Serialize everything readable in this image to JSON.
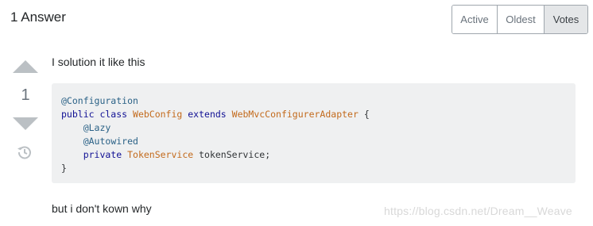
{
  "answers_header": {
    "title": "1 Answer",
    "sort_tabs": [
      {
        "label": "Active",
        "selected": false
      },
      {
        "label": "Oldest",
        "selected": false
      },
      {
        "label": "Votes",
        "selected": true
      }
    ]
  },
  "answer": {
    "vote_count": "1",
    "intro_text": "I solution it like this",
    "code": {
      "line1": {
        "anno": "@Configuration"
      },
      "line2": {
        "kw1": "public class ",
        "type1": "WebConfig",
        "kw2": " extends ",
        "type2": "WebMvcConfigurerAdapter",
        "plain": " {"
      },
      "line3": {
        "indent": "    ",
        "anno": "@Lazy"
      },
      "line4": {
        "indent": "    ",
        "anno": "@Autowired"
      },
      "line5": {
        "indent": "    ",
        "kw": "private ",
        "type": "TokenService",
        "plain": " tokenService;"
      },
      "line6": {
        "plain": "}"
      }
    },
    "outro_text": "but i don't kown why"
  },
  "watermark": "https://blog.csdn.net/Dream__Weave",
  "colors": {
    "vote_arrow": "#bbc0c4",
    "code_bg": "#eff0f1",
    "selected_tab_bg": "#e4e6e8"
  },
  "icons": {
    "vote_up": "up-arrow-icon",
    "vote_down": "down-arrow-icon",
    "history": "history-icon"
  }
}
